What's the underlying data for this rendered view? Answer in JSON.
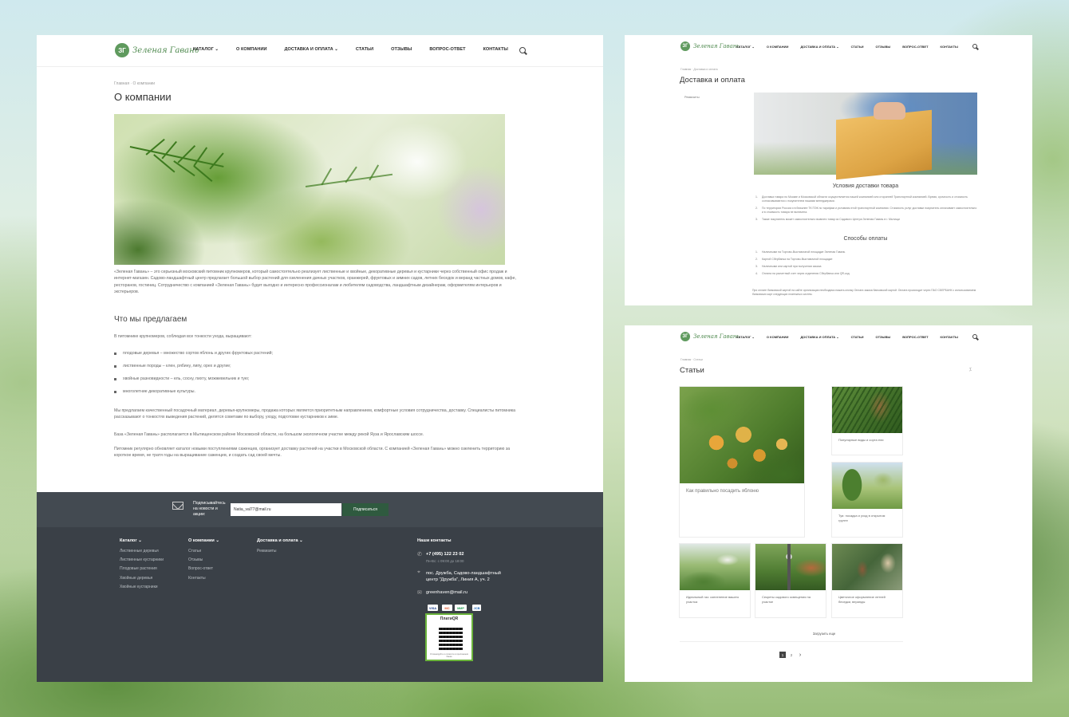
{
  "brand": {
    "logo_text": "Зеленая Гавань",
    "mark": "ЗГ"
  },
  "nav": [
    "Каталог ⌄",
    "О компании",
    "Доставка и оплата ⌄",
    "Статьи",
    "Отзывы",
    "Вопрос-ответ",
    "Контакты"
  ],
  "about": {
    "breadcrumb": "Главная  ·  О компании",
    "title": "О компании",
    "intro": "«Зеленая Гавань» – это серьезный московский питомник крупномеров, который самостоятельно реализует лиственные и хвойные, декоративные деревья и кустарники через собственный офис продаж и интернет-магазин. Садово-ландшафтный центр предлагает большой выбор растений для озеленения дачных участков, оранжерей, фруктовых и зимних садов, летних беседок и веранд частных домов, кафе, ресторанов, гостиниц. Сотрудничество с компанией «Зеленая Гавань» будет выгодно и интересно профессионалам и любителям садоводства, ландшафтным дизайнерам, оформителям интерьеров и экстерьеров.",
    "offer_title": "Что мы предлагаем",
    "offer_lead": "В питомнике крупномеров, соблюдая все тонкости ухода, выращивают:",
    "bullets": [
      "плодовые деревья – множество сортов яблонь и других фруктовых растений;",
      "лиственные породы – клен, рябину, липу, орех и другие;",
      "хвойные разновидности – ель, сосну, пихту, можжевельник и тую;",
      "многолетние декоративные культуры."
    ],
    "p2": "Мы предлагаем качественный посадочный материал, деревья-крупномеры, продажа которых является приоритетным направлением, комфортные условия сотрудничества, доставку. Специалисты питомника рассказывают о тонкостях выведения растений, делятся советами по выбору, уходу, подготовке кустарников к зиме.",
    "p3": "База «Зеленая Гавань» располагается в Мытищенском районе Московской области, на большом экологичном участке между рекой Яуза и Ярославским шоссе.",
    "p4": "Питомник регулярно обновляет каталог новыми поступлениями саженцев, организует доставку растений на участки в Московской области. С компанией «Зеленая Гавань» можно озеленить территорию за короткое время, не тратя годы на выращивание саженцев, и создать сад своей мечты."
  },
  "subscribe": {
    "label": "Подписывайтесь на новости и акции:",
    "value": "Natia_val77@mail.ru",
    "button": "Подписаться"
  },
  "footer": {
    "columns": [
      {
        "title": "Каталог ⌄",
        "items": [
          "Лиственные деревья",
          "Лиственные кустарники",
          "Плодовые растения",
          "Хвойные деревья",
          "Хвойные кустарники"
        ]
      },
      {
        "title": "О компании ⌄",
        "items": [
          "Статьи",
          "Отзывы",
          "Вопрос-ответ",
          "Контакты"
        ]
      },
      {
        "title": "Доставка и оплата ⌄",
        "items": [
          "Реквизиты"
        ]
      }
    ],
    "contacts_title": "Наши контакты",
    "phone": "+7 (495) 122 23 02",
    "hours": "Пн-Вс: с 09:00 до 18:00",
    "address": "пос. Дружба, Садово-ландшафтный центр \"Дружба\", Линия А, уч. 2",
    "email": "greenhaven@mail.ru",
    "payments": [
      "VISA",
      "MC",
      "МИР",
      "JCB"
    ],
    "qr_title": "ПлатиQR",
    "qr_note": "Отсканируйте и оплатите в приложении банка"
  },
  "delivery": {
    "breadcrumb": "Главная  ·  Доставка и оплата",
    "title": "Доставка и оплата",
    "side_link": "Реквизиты",
    "cond_title": "Условия доставки товара",
    "cond": [
      "Доставка товара по Москве и Московской области осуществляется нашей компанией или сторонней Транспортной компанией. Время, срочность и стоимость согласовываются с покупателем нашими менеджерами.",
      "По территории России и в ближнее ТК ПЭК по тарифам и условиям этой транспортной компании. Стоимость услуг доставки покупатель оплачивает самостоятельно и в стоимость товара не включена.",
      "Также покупатель может самостоятельно вывезти товар из Садового Центра Зеленая Гавань в г. Мытищи"
    ],
    "pay_title": "Способы оплаты",
    "pay": [
      "Наличными на Торгово-Выставочной площадке Зеленая Гавань",
      "Картой Сбербанка на Торгово-Выставочной площадке",
      "Наличными или картой при получении заказа",
      "Оплата на расчетный счет через отделения Сбербанка или QR-код"
    ],
    "note": "При оплате банковской картой на сайте организации необходимо нажать кнопку Оплата заказа банковской картой. Оплата происходит через ПАО СБЕРБАНК с использованием банковских карт следующих платежных систем."
  },
  "articles": {
    "breadcrumb": "Главная  ·  Статьи",
    "title": "Статьи",
    "rss": "RSS",
    "items": [
      "Как правильно посадить яблоню",
      "Популярные виды и сорта ели",
      "Туя: посадка и уход в открытом грунте",
      "Идеальный газ: озеленение вашего участка",
      "Секреты садового освещения на участке",
      "Цветочное оформление летней беседки, веранды"
    ],
    "load_more": "Загрузить еще",
    "pages": [
      "1",
      "2",
      "›"
    ]
  },
  "colors": {
    "accent": "#5f9a5e",
    "footer": "#3a4047",
    "subscribe_bar": "#434a51",
    "button": "#2f5a3f"
  }
}
